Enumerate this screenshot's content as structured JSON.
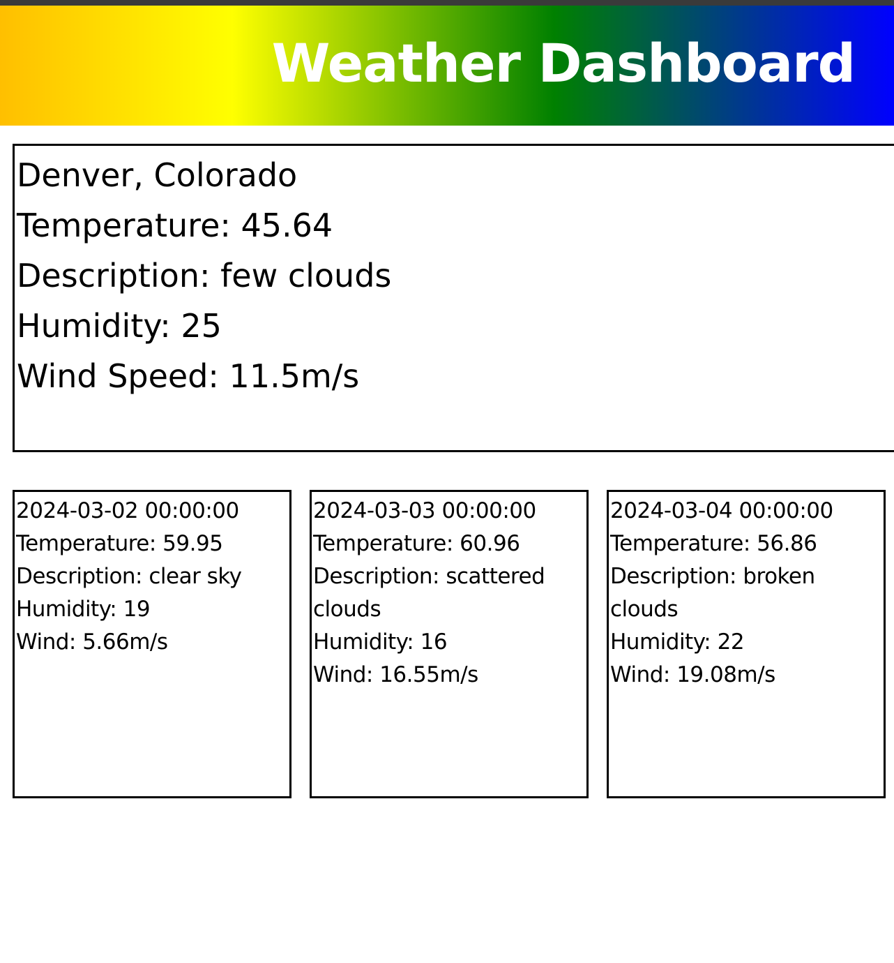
{
  "header": {
    "title": "Weather Dashboard"
  },
  "colors": {
    "header_gradient": [
      "#ffbf00",
      "#ffff00",
      "#008000",
      "#0000ff"
    ],
    "title": "#ffffff",
    "border": "#000000"
  },
  "current": {
    "location": "Denver, Colorado",
    "temperature": "Temperature: 45.64",
    "description": "Description: few clouds",
    "humidity": "Humidity: 25",
    "wind_speed": "Wind Speed: 11.5m/s"
  },
  "forecast": [
    {
      "datetime": "2024-03-02 00:00:00",
      "temperature": "Temperature: 59.95",
      "description": "Description: clear sky",
      "humidity": "Humidity: 19",
      "wind": "Wind: 5.66m/s"
    },
    {
      "datetime": "2024-03-03 00:00:00",
      "temperature": "Temperature: 60.96",
      "description": "Description: scattered clouds",
      "humidity": "Humidity: 16",
      "wind": "Wind: 16.55m/s"
    },
    {
      "datetime": "2024-03-04 00:00:00",
      "temperature": "Temperature: 56.86",
      "description": "Description: broken clouds",
      "humidity": "Humidity: 22",
      "wind": "Wind: 19.08m/s"
    }
  ]
}
